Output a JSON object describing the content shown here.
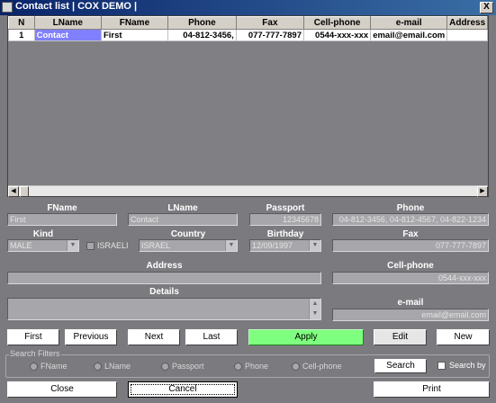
{
  "window": {
    "title": "Contact list | COX DEMO |",
    "close_glyph": "X"
  },
  "grid": {
    "columns": [
      "N",
      "LName",
      "FName",
      "Phone",
      "Fax",
      "Cell-phone",
      "e-mail",
      "Address"
    ],
    "rows": [
      {
        "n": "1",
        "lname": "Contact",
        "fname": "First",
        "phone": "04-812-3456,",
        "fax": "077-777-7897",
        "cell": "0544-xxx-xxx",
        "email": "email@email.com",
        "address": ""
      }
    ]
  },
  "form": {
    "fname_label": "FName",
    "fname_value": "First",
    "lname_label": "LName",
    "lname_value": "Contact",
    "passport_label": "Passport",
    "passport_value": "12345678",
    "phone_label": "Phone",
    "phone_value": "04-812-3456, 04-812-4567, 04-822-1234",
    "kind_label": "Kind",
    "kind_value": "MALE",
    "israeli_label": "ISRAELI",
    "country_label": "Country",
    "country_value": "ISRAEL",
    "birthday_label": "Birthday",
    "birthday_value": "12/09/1997",
    "fax_label": "Fax",
    "fax_value": "077-777-7897",
    "address_label": "Address",
    "address_value": "",
    "cell_label": "Cell-phone",
    "cell_value": "0544-xxx-xxx",
    "details_label": "Details",
    "details_value": "",
    "email_label": "e-mail",
    "email_value": "email@email.com"
  },
  "nav": {
    "first": "First",
    "previous": "Previous",
    "next": "Next",
    "last": "Last",
    "apply": "Apply",
    "edit": "Edit",
    "new": "New"
  },
  "filters": {
    "legend": "Search Filters",
    "options": [
      "FName",
      "LName",
      "Passport",
      "Phone",
      "Cell-phone"
    ],
    "search_button": "Search",
    "search_by_label": "Search by"
  },
  "bottom": {
    "close": "Close",
    "cancel": "Cancel",
    "print": "Print"
  },
  "colors": {
    "background": "#7b7b7f",
    "selected_cell": "#8080ff",
    "apply_button": "#7fff7f",
    "title_bar": "#0a246a"
  }
}
